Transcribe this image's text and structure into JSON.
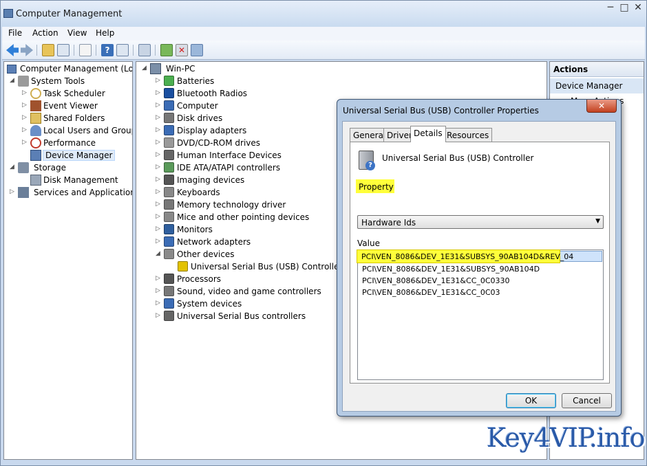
{
  "window": {
    "title": "Computer Management",
    "controls": {
      "minimize": "─",
      "maximize": "□",
      "close": "✕"
    }
  },
  "menu": [
    "File",
    "Action",
    "View",
    "Help"
  ],
  "left_tree": [
    {
      "label": "Computer Management (Local",
      "expand": "",
      "icon": "computer-management-icon",
      "color": "#5b7fb5"
    },
    {
      "label": "System Tools",
      "expand": "◢",
      "icon": "tools-icon",
      "color": "#888888"
    },
    {
      "label": "Task Scheduler",
      "expand": "▷",
      "icon": "clock-icon",
      "color": "#cfae52"
    },
    {
      "label": "Event Viewer",
      "expand": "▷",
      "icon": "event-viewer-icon",
      "color": "#a0522d"
    },
    {
      "label": "Shared Folders",
      "expand": "▷",
      "icon": "shared-folder-icon",
      "color": "#e0c060"
    },
    {
      "label": "Local Users and Groups",
      "expand": "▷",
      "icon": "users-icon",
      "color": "#6a8fc8"
    },
    {
      "label": "Performance",
      "expand": "▷",
      "icon": "performance-icon",
      "color": "#c0392b"
    },
    {
      "label": "Device Manager",
      "expand": "",
      "icon": "device-manager-icon",
      "color": "#5b7fb5",
      "selected": true
    },
    {
      "label": "Storage",
      "expand": "◢",
      "icon": "storage-icon",
      "color": "#7f8fa4"
    },
    {
      "label": "Disk Management",
      "expand": "",
      "icon": "disk-icon",
      "color": "#7f8fa4"
    },
    {
      "label": "Services and Applications",
      "expand": "▷",
      "icon": "services-icon",
      "color": "#6b7f99"
    }
  ],
  "device_tree": {
    "root": "Win-PC",
    "items": [
      {
        "label": "Batteries",
        "expand": "▷",
        "icon": "battery-icon",
        "color": "#4caf50"
      },
      {
        "label": "Bluetooth Radios",
        "expand": "▷",
        "icon": "bluetooth-icon",
        "color": "#1a4fa0"
      },
      {
        "label": "Computer",
        "expand": "▷",
        "icon": "computer-icon",
        "color": "#3b6cb5"
      },
      {
        "label": "Disk drives",
        "expand": "▷",
        "icon": "disk-drive-icon",
        "color": "#777777"
      },
      {
        "label": "Display adapters",
        "expand": "▷",
        "icon": "display-adapter-icon",
        "color": "#3b6cb5"
      },
      {
        "label": "DVD/CD-ROM drives",
        "expand": "▷",
        "icon": "dvd-icon",
        "color": "#999999"
      },
      {
        "label": "Human Interface Devices",
        "expand": "▷",
        "icon": "hid-icon",
        "color": "#666666"
      },
      {
        "label": "IDE ATA/ATAPI controllers",
        "expand": "▷",
        "icon": "ide-icon",
        "color": "#5a9a5a"
      },
      {
        "label": "Imaging devices",
        "expand": "▷",
        "icon": "camera-icon",
        "color": "#555555"
      },
      {
        "label": "Keyboards",
        "expand": "▷",
        "icon": "keyboard-icon",
        "color": "#888888"
      },
      {
        "label": "Memory technology driver",
        "expand": "▷",
        "icon": "memory-icon",
        "color": "#777777"
      },
      {
        "label": "Mice and other pointing devices",
        "expand": "▷",
        "icon": "mouse-icon",
        "color": "#888888"
      },
      {
        "label": "Monitors",
        "expand": "▷",
        "icon": "monitor-icon",
        "color": "#2f5f9e"
      },
      {
        "label": "Network adapters",
        "expand": "▷",
        "icon": "network-icon",
        "color": "#3b6cb5"
      },
      {
        "label": "Other devices",
        "expand": "◢",
        "icon": "other-devices-icon",
        "color": "#8a8a8a"
      },
      {
        "label": "Universal Serial Bus (USB) Controller",
        "expand": "",
        "icon": "warning-device-icon",
        "color": "#e2c200",
        "child": true
      },
      {
        "label": "Processors",
        "expand": "▷",
        "icon": "processor-icon",
        "color": "#555555"
      },
      {
        "label": "Sound, video and game controllers",
        "expand": "▷",
        "icon": "sound-icon",
        "color": "#777777"
      },
      {
        "label": "System devices",
        "expand": "▷",
        "icon": "system-devices-icon",
        "color": "#3b6cb5"
      },
      {
        "label": "Universal Serial Bus controllers",
        "expand": "▷",
        "icon": "usb-icon",
        "color": "#666666"
      }
    ]
  },
  "actions_pane": {
    "header": "Actions",
    "item": "Device Manager",
    "more": "More Actions"
  },
  "dialog": {
    "title": "Universal Serial Bus (USB) Controller Properties",
    "close": "✕",
    "tabs": [
      "General",
      "Driver",
      "Details",
      "Resources"
    ],
    "active_tab": "Details",
    "device_name": "Universal Serial Bus (USB) Controller",
    "property_label": "Property",
    "property_value": "Hardware Ids",
    "value_label": "Value",
    "values": [
      "PCI\\VEN_8086&DEV_1E31&SUBSYS_90AB104D&REV_04",
      "PCI\\VEN_8086&DEV_1E31&SUBSYS_90AB104D",
      "PCI\\VEN_8086&DEV_1E31&CC_0C0330",
      "PCI\\VEN_8086&DEV_1E31&CC_0C03"
    ],
    "ok": "OK",
    "cancel": "Cancel",
    "highlight_color": "#ffff3a"
  },
  "watermark": "Key4VIP.info"
}
